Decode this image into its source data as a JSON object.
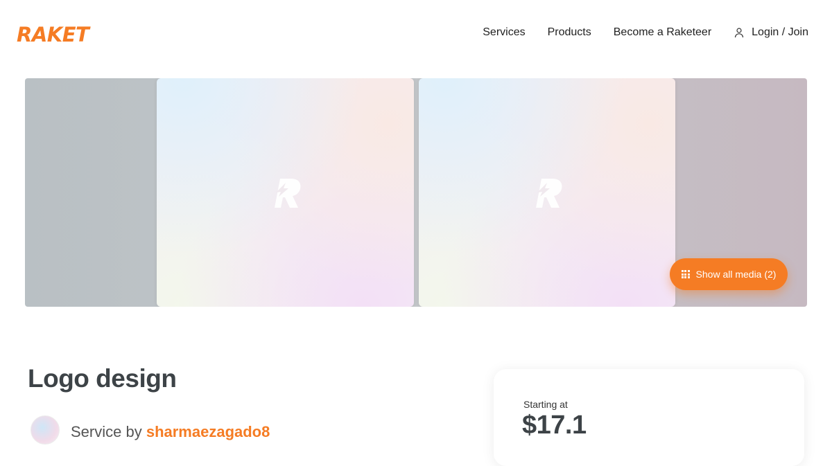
{
  "header": {
    "logo_text": "RAKET",
    "nav": {
      "services": "Services",
      "products": "Products",
      "become": "Become a Raketeer",
      "login": "Login / Join"
    }
  },
  "gallery": {
    "tiles": [
      {
        "icon": "raket-r-icon"
      },
      {
        "icon": "raket-r-icon"
      }
    ],
    "show_media_label": "Show all media (2)"
  },
  "service": {
    "title": "Logo design",
    "by_prefix": "Service by ",
    "seller": "sharmaezagado8"
  },
  "pricing": {
    "starting_label": "Starting at",
    "price": "$17.1"
  },
  "colors": {
    "accent": "#f57c24",
    "title": "#3d4347"
  },
  "icons": {
    "user": "user-icon",
    "grid": "grid-icon"
  }
}
